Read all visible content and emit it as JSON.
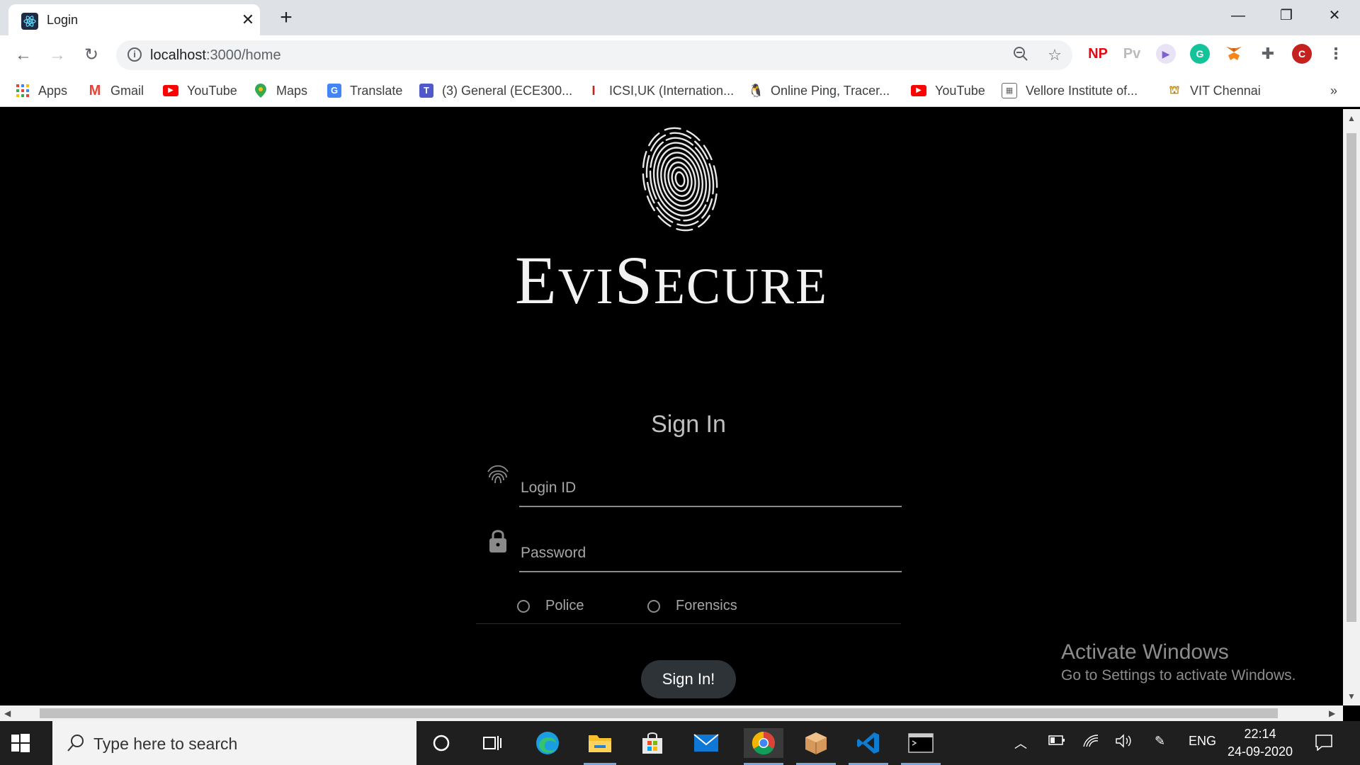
{
  "browser": {
    "tab_title": "Login",
    "new_tab_symbol": "+",
    "url_host": "localhost",
    "url_path": ":3000/home"
  },
  "extensions": [
    "NP",
    "Pv",
    "C"
  ],
  "bookmarks": [
    {
      "label": "Apps",
      "icon": "apps-grid-icon"
    },
    {
      "label": "Gmail",
      "icon": "gmail-icon"
    },
    {
      "label": "YouTube",
      "icon": "youtube-icon"
    },
    {
      "label": "Maps",
      "icon": "maps-icon"
    },
    {
      "label": "Translate",
      "icon": "translate-icon"
    },
    {
      "label": "(3) General (ECE300...",
      "icon": "teams-icon"
    },
    {
      "label": "ICSI,UK (Internation...",
      "icon": "icsi-icon"
    },
    {
      "label": "Online Ping, Tracer...",
      "icon": "penguin-icon"
    },
    {
      "label": "YouTube",
      "icon": "youtube-icon"
    },
    {
      "label": "Vellore Institute of...",
      "icon": "vit-icon"
    },
    {
      "label": "VIT Chennai",
      "icon": "vit-chennai-icon"
    }
  ],
  "page": {
    "brand_first": "E",
    "brand_rest1": "VI",
    "brand_mid": "S",
    "brand_rest2": "ECURE",
    "signin_title": "Sign In",
    "login_placeholder": "Login ID",
    "password_placeholder": "Password",
    "radio_police": "Police",
    "radio_forensics": "Forensics",
    "signin_button": "Sign In!"
  },
  "watermark": {
    "title": "Activate Windows",
    "subtitle": "Go to Settings to activate Windows."
  },
  "taskbar": {
    "search_placeholder": "Type here to search",
    "language": "ENG",
    "time": "22:14",
    "date": "24-09-2020"
  },
  "colors": {
    "page_bg": "#000000",
    "button_bg": "#2e3338",
    "taskbar_bg": "#1f1f1f"
  }
}
